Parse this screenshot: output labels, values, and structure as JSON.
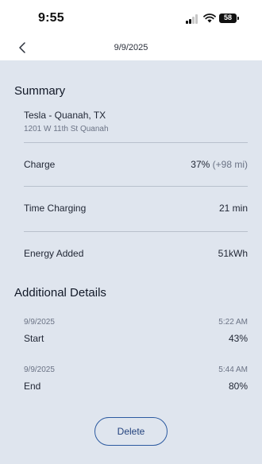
{
  "status_bar": {
    "time": "9:55",
    "battery": "58"
  },
  "nav": {
    "title": "9/9/2025"
  },
  "summary": {
    "heading": "Summary",
    "merchant_name": "Tesla - Quanah, TX",
    "merchant_address": "1201 W 11th St Quanah",
    "rows": [
      {
        "label": "Charge",
        "value": "37%",
        "extra": "(+98 mi)"
      },
      {
        "label": "Time Charging",
        "value": "21 min"
      },
      {
        "label": "Energy Added",
        "value": "51kWh"
      }
    ]
  },
  "details": {
    "heading": "Additional Details",
    "items": [
      {
        "date": "9/9/2025",
        "time": "5:22 AM",
        "label": "Start",
        "value": "43%"
      },
      {
        "date": "9/9/2025",
        "time": "5:44 AM",
        "label": "End",
        "value": "80%"
      }
    ]
  },
  "actions": {
    "delete_label": "Delete"
  },
  "colors": {
    "background": "#dfe5ee",
    "accent": "#2c5aa0",
    "divider": "#b8c0cc"
  }
}
